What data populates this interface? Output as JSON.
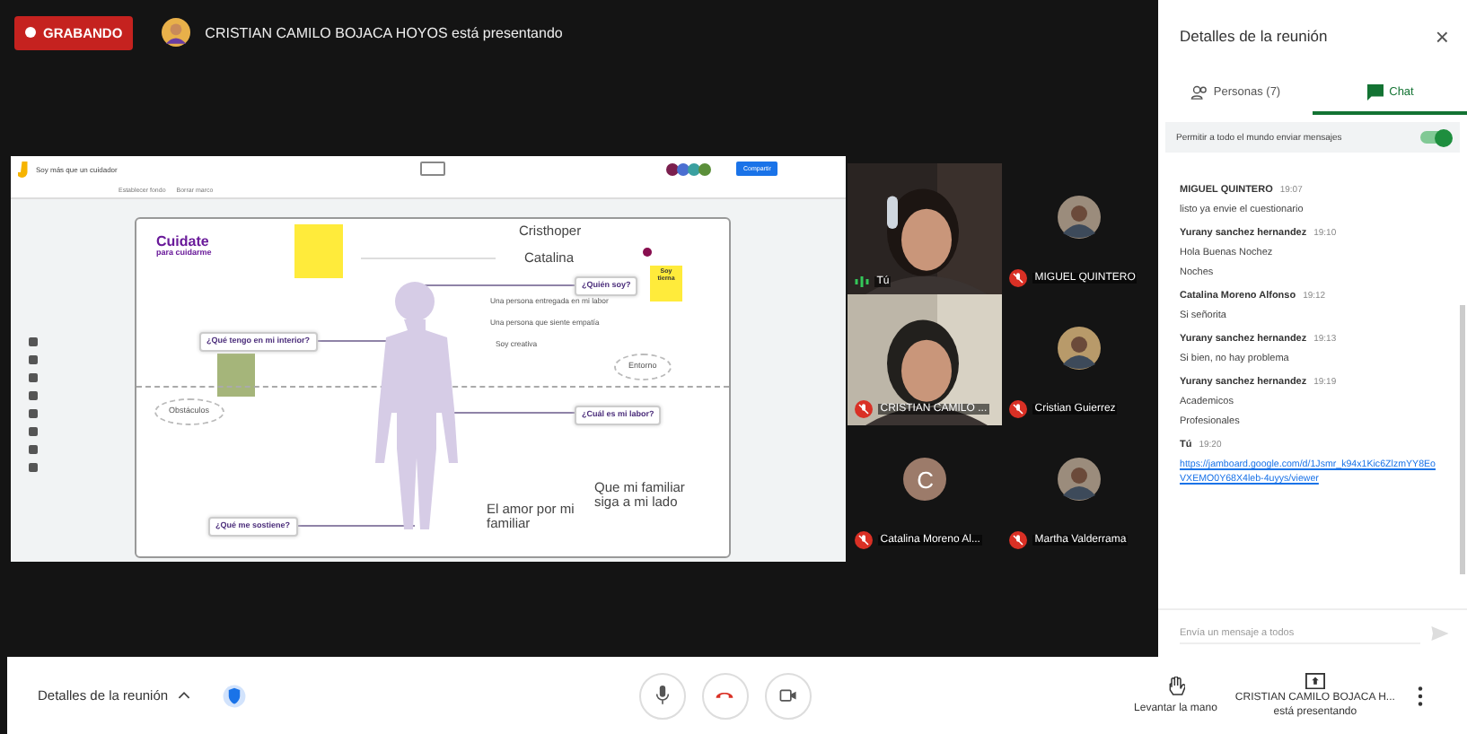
{
  "recording": {
    "label": "GRABANDO"
  },
  "presenter_banner": "CRISTIAN CAMILO BOJACA HOYOS está presentando",
  "presentation": {
    "title": "Soy más que un cuidador",
    "share_button": "Compartir",
    "toolbar": [
      "Establecer fondo",
      "Borrar marco"
    ],
    "board": {
      "logo": "Cuidate",
      "logo_sub": "para cuidarme",
      "items": [
        {
          "kind": "heading",
          "text": "Cristhoper"
        },
        {
          "kind": "heading",
          "text": "Catalina"
        },
        {
          "kind": "question",
          "text": "¿Quién soy?"
        },
        {
          "kind": "text",
          "text": "Una persona entregada en mi labor"
        },
        {
          "kind": "text",
          "text": "Una persona que siente empatía"
        },
        {
          "kind": "text",
          "text": "Soy creativa"
        },
        {
          "kind": "ellipse",
          "text": "Entorno"
        },
        {
          "kind": "question",
          "text": "¿Qué tengo en mi interior?"
        },
        {
          "kind": "ellipse",
          "text": "Obstáculos"
        },
        {
          "kind": "question",
          "text": "¿Cuál es mi labor?"
        },
        {
          "kind": "question",
          "text": "¿Qué me sostiene?"
        },
        {
          "kind": "heading",
          "text": "El amor por mi familiar"
        },
        {
          "kind": "heading",
          "text": "Que mi familiar siga a mi lado"
        },
        {
          "kind": "sticky",
          "text": "Soy tierna"
        }
      ]
    }
  },
  "tiles": [
    {
      "name": "Tú",
      "kind": "video",
      "muted": false
    },
    {
      "name": "MIGUEL QUINTERO",
      "kind": "avatar",
      "muted": true
    },
    {
      "name": "CRISTIAN CAMILO ...",
      "kind": "video",
      "muted": true
    },
    {
      "name": "Cristian Guierrez",
      "kind": "avatar",
      "muted": true
    },
    {
      "name": "Catalina Moreno Al...",
      "kind": "letter",
      "initial": "C",
      "muted": true
    },
    {
      "name": "Martha Valderrama",
      "kind": "avatar",
      "muted": true
    }
  ],
  "panel": {
    "title": "Detalles de la reunión",
    "close": "×",
    "tabs": [
      {
        "label": "Personas (7)",
        "selected": false
      },
      {
        "label": "Chat",
        "selected": true
      }
    ],
    "allow_messages": {
      "label": "Permitir a todo el mundo enviar mensajes",
      "on": true
    },
    "messages": [
      {
        "sender": "MIGUEL QUINTERO",
        "time": "19:07",
        "lines": [
          "listo ya envie el cuestionario"
        ]
      },
      {
        "sender": "Yurany sanchez hernandez",
        "time": "19:10",
        "lines": [
          "Hola Buenas Nochez",
          "Noches"
        ]
      },
      {
        "sender": "Catalina Moreno Alfonso",
        "time": "19:12",
        "lines": [
          "Si señorita"
        ]
      },
      {
        "sender": "Yurany sanchez hernandez",
        "time": "19:13",
        "lines": [
          "Si bien, no hay problema"
        ]
      },
      {
        "sender": "Yurany sanchez hernandez",
        "time": "19:19",
        "lines": [
          "Academicos",
          "Profesionales"
        ]
      },
      {
        "sender": "Tú",
        "time": "19:20",
        "link": "https://jamboard.google.com/d/1Jsmr_k94x1Kic6ZlzmYY8EoVXEMO0Y68X4leb-4uyys/viewer"
      }
    ],
    "input": {
      "placeholder": "Envía un mensaje a todos"
    }
  },
  "bottom_bar": {
    "details": "Detalles de la reunión",
    "raise_hand": "Levantar la mano",
    "presenting_name": "CRISTIAN CAMILO BOJACA H...",
    "presenting_label": "está presentando"
  }
}
